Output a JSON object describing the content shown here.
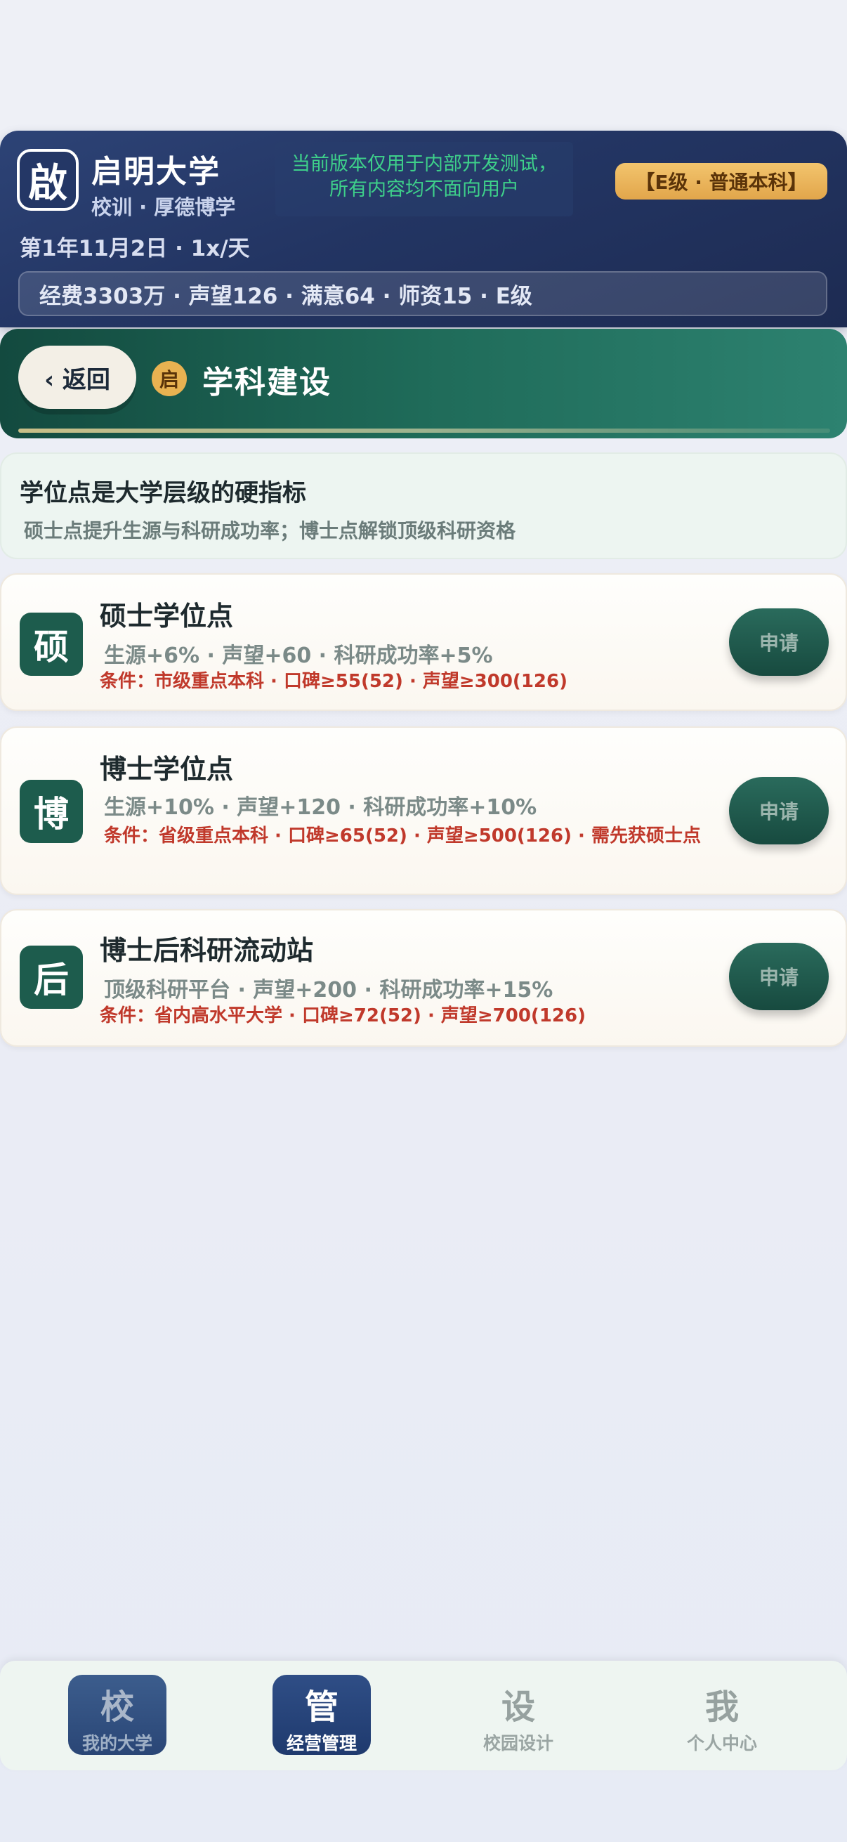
{
  "header": {
    "logo_char": "啟",
    "university_name": "启明大学",
    "motto": "校训 · 厚德博学",
    "notice_line1": "当前版本仅用于内部开发测试，",
    "notice_line2": "所有内容均不面向用户",
    "level_badge": "【E级 · 普通本科】",
    "date_speed": "第1年11月2日 · 1x/天",
    "stats": "经费3303万 · 声望126 · 满意64 · 师资15 · E级"
  },
  "section": {
    "back_label": "‹ 返回",
    "icon_char": "启",
    "title": "学科建设"
  },
  "info": {
    "title": "学位点是大学层级的硬指标",
    "subtitle": "硕士点提升生源与科研成功率；博士点解锁顶级科研资格"
  },
  "degrees": [
    {
      "icon": "硕",
      "title": "硕士学位点",
      "effects": "生源+6% · 声望+60 · 科研成功率+5%",
      "conditions": "条件：市级重点本科 · 口碑≥55(52) · 声望≥300(126)",
      "button": "申请"
    },
    {
      "icon": "博",
      "title": "博士学位点",
      "effects": "生源+10% · 声望+120 · 科研成功率+10%",
      "conditions": "条件：省级重点本科 · 口碑≥65(52) · 声望≥500(126) · 需先获硕士点",
      "button": "申请"
    },
    {
      "icon": "后",
      "title": "博士后科研流动站",
      "effects": "顶级科研平台 · 声望+200 · 科研成功率+15%",
      "conditions": "条件：省内高水平大学 · 口碑≥72(52) · 声望≥700(126)",
      "button": "申请"
    }
  ],
  "nav": [
    {
      "glyph": "校",
      "label": "我的大学"
    },
    {
      "glyph": "管",
      "label": "经营管理"
    },
    {
      "glyph": "设",
      "label": "校园设计"
    },
    {
      "glyph": "我",
      "label": "个人中心"
    }
  ],
  "colors": {
    "header_bg": "#233563",
    "section_bg": "#1f6b59",
    "accent_gold": "#e8b251",
    "condition_red": "#c0392b",
    "notice_green": "#3ed08a"
  }
}
